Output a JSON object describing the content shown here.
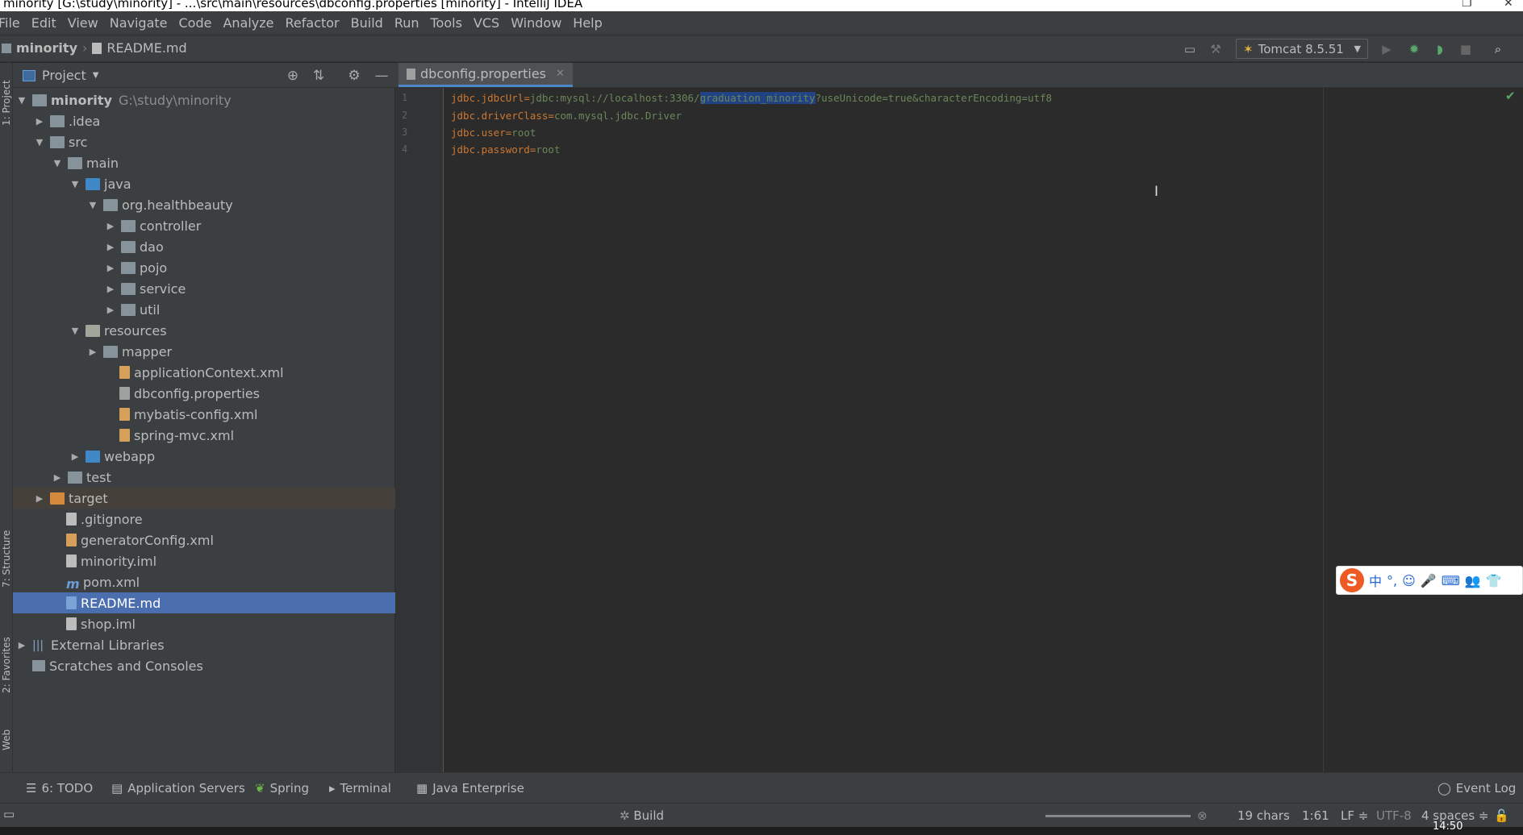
{
  "window": {
    "title": "minority [G:\\study\\minority] - ...\\src\\main\\resources\\dbconfig.properties [minority] - IntelliJ IDEA"
  },
  "menu": [
    "File",
    "Edit",
    "View",
    "Navigate",
    "Code",
    "Analyze",
    "Refactor",
    "Build",
    "Run",
    "Tools",
    "VCS",
    "Window",
    "Help"
  ],
  "breadcrumb": {
    "project": "minority",
    "file": "README.md"
  },
  "run_config": {
    "label": "Tomcat 8.5.51"
  },
  "left_strip": {
    "project_tab": "1: Project",
    "structure_tab": "7: Structure",
    "favorites_tab": "2: Favorites",
    "web_tab": "Web"
  },
  "project_panel": {
    "title": "Project",
    "tree": [
      {
        "label": "minority",
        "hint": "G:\\study\\minority"
      },
      {
        "label": ".idea"
      },
      {
        "label": "src"
      },
      {
        "label": "main"
      },
      {
        "label": "java"
      },
      {
        "label": "org.healthbeauty"
      },
      {
        "label": "controller"
      },
      {
        "label": "dao"
      },
      {
        "label": "pojo"
      },
      {
        "label": "service"
      },
      {
        "label": "util"
      },
      {
        "label": "resources"
      },
      {
        "label": "mapper"
      },
      {
        "label": "applicationContext.xml"
      },
      {
        "label": "dbconfig.properties"
      },
      {
        "label": "mybatis-config.xml"
      },
      {
        "label": "spring-mvc.xml"
      },
      {
        "label": "webapp"
      },
      {
        "label": "test"
      },
      {
        "label": "target"
      },
      {
        "label": ".gitignore"
      },
      {
        "label": "generatorConfig.xml"
      },
      {
        "label": "minority.iml"
      },
      {
        "label": "pom.xml"
      },
      {
        "label": "README.md"
      },
      {
        "label": "shop.iml"
      },
      {
        "label": "External Libraries"
      },
      {
        "label": "Scratches and Consoles"
      }
    ]
  },
  "editor": {
    "tab": "dbconfig.properties",
    "lines": [
      {
        "num": "1",
        "key": "jdbc.jdbcUrl",
        "eq": "=",
        "pre": "jdbc:mysql://localhost:3306/",
        "sel": "graduation_minority",
        "post": "?useUnicode=true&characterEncoding=utf8"
      },
      {
        "num": "2",
        "key": "jdbc.driverClass",
        "eq": "=",
        "pre": "com.mysql.jdbc.Driver",
        "sel": "",
        "post": ""
      },
      {
        "num": "3",
        "key": "jdbc.user",
        "eq": "=",
        "pre": "root",
        "sel": "",
        "post": ""
      },
      {
        "num": "4",
        "key": "jdbc.password",
        "eq": "=",
        "pre": "root",
        "sel": "",
        "post": ""
      }
    ]
  },
  "ime": {
    "logo": "S",
    "mode": "中"
  },
  "bottom_tools": {
    "todo": "6: TODO",
    "app_servers": "Application Servers",
    "spring": "Spring",
    "terminal": "Terminal",
    "java_enterprise": "Java Enterprise",
    "event_log": "Event Log"
  },
  "status": {
    "build": "Build",
    "chars": "19 chars",
    "position": "1:61",
    "line_sep": "LF",
    "encoding": "UTF-8",
    "indent": "4 spaces"
  },
  "clock": "14:50",
  "colors": {
    "accent": "#4b6eaf",
    "keyword": "#cc7832",
    "value": "#6a8759",
    "selection": "#214283"
  }
}
